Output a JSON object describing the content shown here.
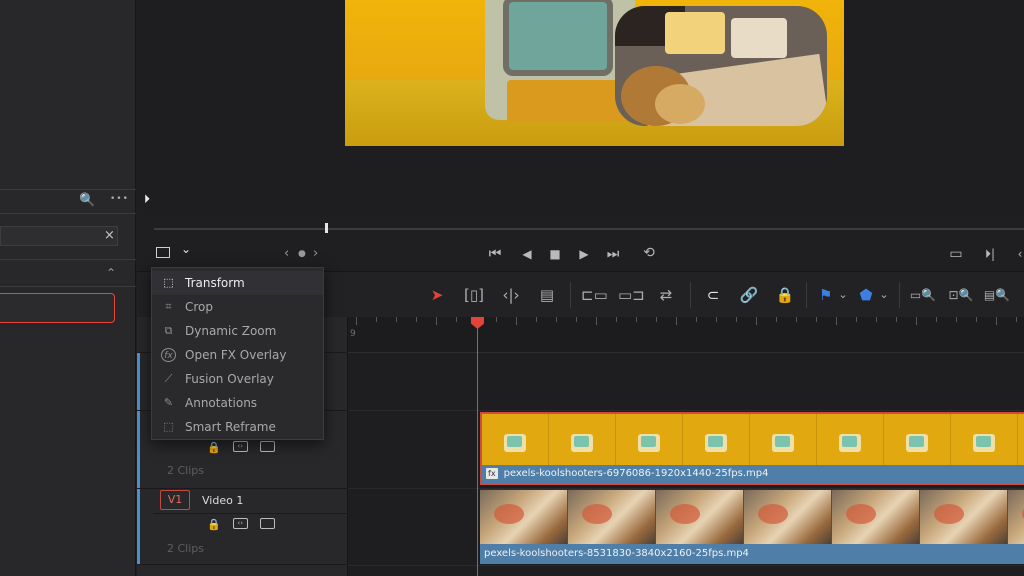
{
  "menu": {
    "items": [
      {
        "label": "Transform",
        "icon": "transform-icon",
        "active": true
      },
      {
        "label": "Crop",
        "icon": "crop-icon",
        "active": false
      },
      {
        "label": "Dynamic Zoom",
        "icon": "dynamic-zoom-icon",
        "active": false
      },
      {
        "label": "Open FX Overlay",
        "icon": "fx-icon",
        "active": false
      },
      {
        "label": "Fusion Overlay",
        "icon": "fusion-icon",
        "active": false
      },
      {
        "label": "Annotations",
        "icon": "pen-icon",
        "active": false
      },
      {
        "label": "Smart Reframe",
        "icon": "reframe-icon",
        "active": false
      }
    ]
  },
  "tracks": {
    "v2": {
      "clips_label": "2 Clips",
      "clip_name": "pexels-koolshooters-6976086-1920x1440-25fps.mp4",
      "fx_badge": "fx"
    },
    "v1": {
      "tag": "V1",
      "name": "Video 1",
      "clips_label": "2 Clips",
      "clip_name": "pexels-koolshooters-8531830-3840x2160-25fps.mp4"
    }
  },
  "ruler": {
    "first_label": "9"
  },
  "glyphs": {
    "search": "🔍",
    "more": "•••",
    "clear": "×",
    "collapse": "⌃",
    "play_marker": "⏵",
    "chevron": "⌄",
    "nav_prev": "‹",
    "nav_dot": "●",
    "nav_next": "›",
    "go_start": "⏮",
    "play_reverse": "◀",
    "stop": "■",
    "play": "▶",
    "go_end": "⏭",
    "loop": "⟲",
    "match_frame": "▭",
    "next_frame": "⏵|",
    "fx": "fx",
    "lock": "🔒",
    "auto_select": "⌸",
    "monitor": "▭"
  },
  "colors": {
    "accent_red": "#e2443a",
    "clip_blue": "#4f7fa8",
    "track_accent": "#4a8fd0"
  }
}
